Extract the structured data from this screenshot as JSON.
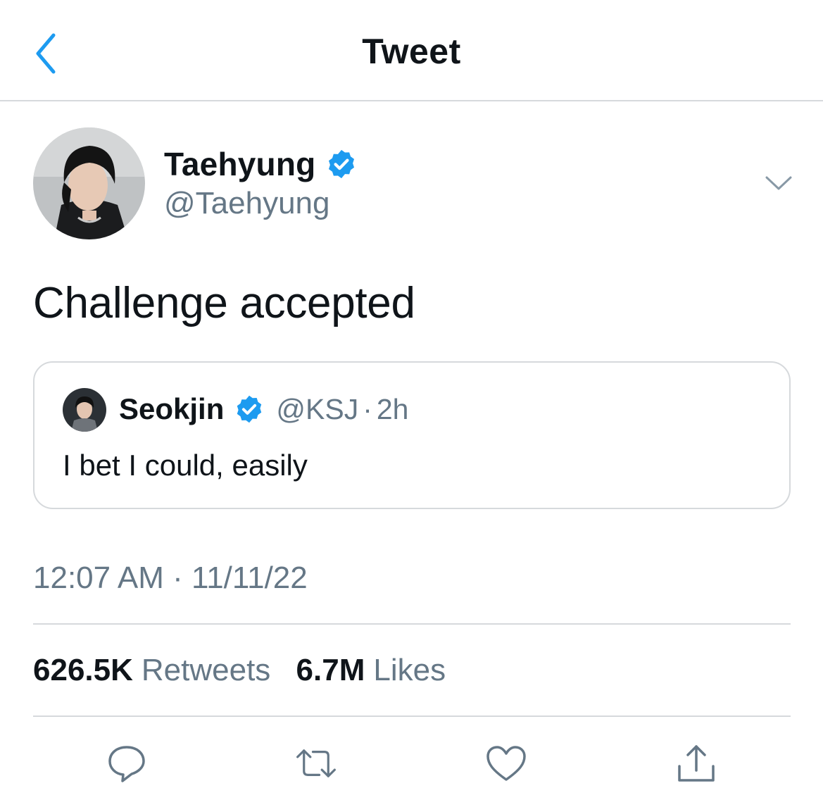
{
  "header": {
    "title": "Tweet",
    "back_icon": "chevron-left-icon"
  },
  "author": {
    "name": "Taehyung",
    "handle": "@Taehyung",
    "verified": true
  },
  "tweet": {
    "text": "Challenge accepted"
  },
  "quote": {
    "name": "Seokjin",
    "handle": "@KSJ",
    "separator": "·",
    "time": "2h",
    "text": "I bet I could, easily",
    "verified": true
  },
  "timestamp": "12:07 AM · 11/11/22",
  "stats": {
    "retweets_count": "626.5K",
    "retweets_label": "Retweets",
    "likes_count": "6.7M",
    "likes_label": "Likes"
  },
  "actions": [
    "reply-icon",
    "retweet-icon",
    "like-icon",
    "share-icon"
  ],
  "colors": {
    "accent": "#1d9bf0",
    "muted": "#657786",
    "icon": "#657786",
    "divider": "#d6d9dc"
  }
}
